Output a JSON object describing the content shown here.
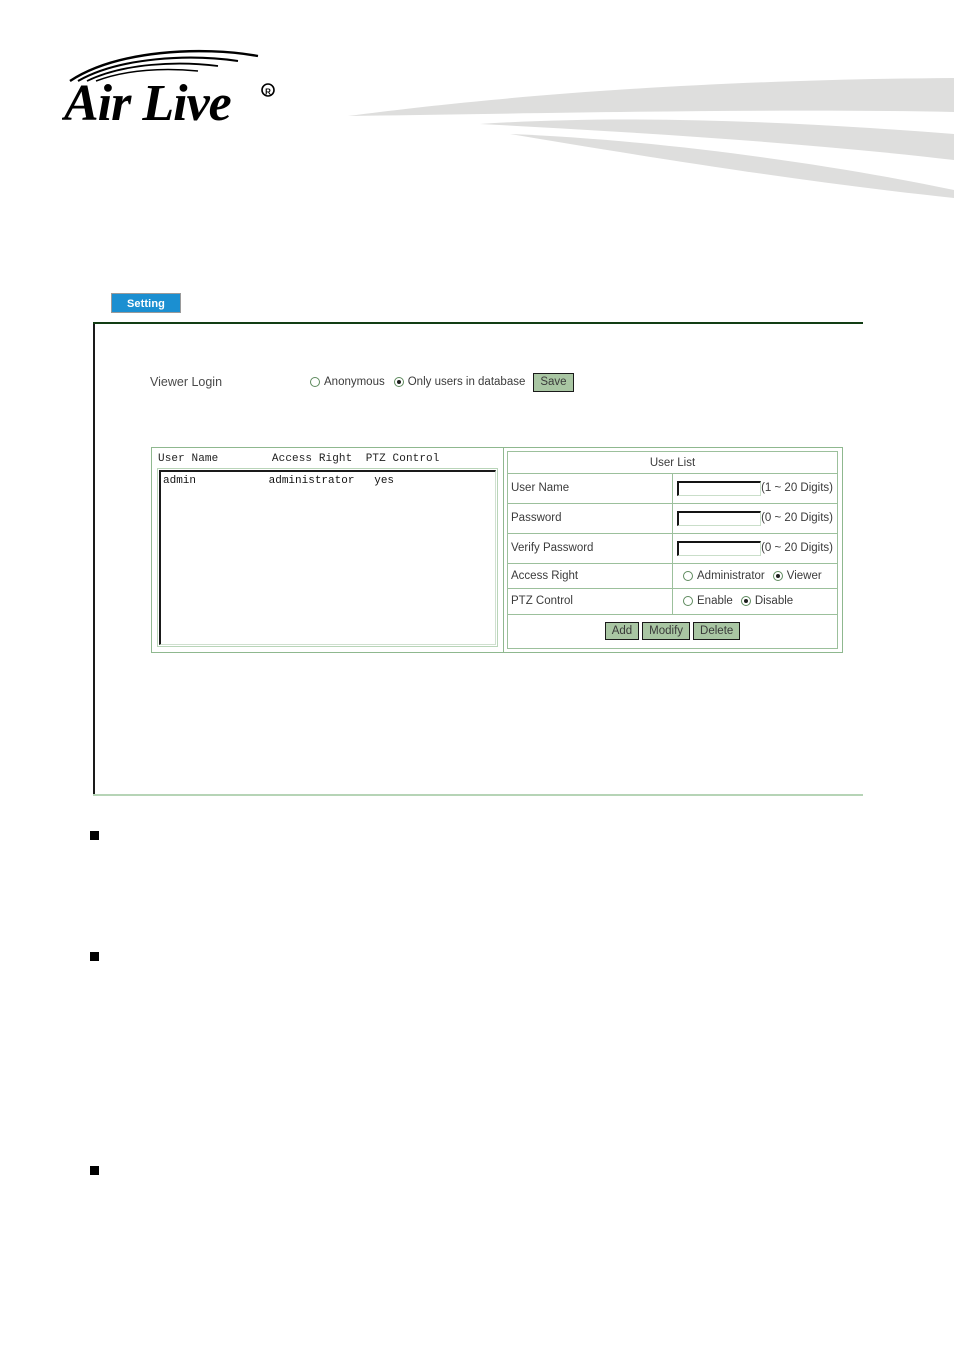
{
  "brand": {
    "name": "Air Live",
    "logo_icon": "airlive-logo",
    "registered_mark": "®",
    "banner_icon": "banner-swoosh"
  },
  "tab": {
    "label": "Setting",
    "accent_color": "#1b8fd1"
  },
  "panel": {
    "border_top_color": "#123d14",
    "border_bottom_color": "#b6d4b6"
  },
  "viewer_login": {
    "label": "Viewer Login",
    "options": [
      {
        "label": "Anonymous",
        "selected": false
      },
      {
        "label": "Only users in database",
        "selected": true
      }
    ],
    "save_label": "Save",
    "button_color": "#a9c6a3"
  },
  "user_table": {
    "header_line": "User Name        Access Right  PTZ Control",
    "columns": [
      "User Name",
      "Access Right",
      "PTZ Control"
    ],
    "rows": [
      {
        "line": "admin           administrator   yes",
        "user_name": "admin",
        "access_right": "administrator",
        "ptz_control": "yes"
      }
    ]
  },
  "user_form": {
    "title": "User List",
    "fields": [
      {
        "label": "User Name",
        "value": "",
        "hint": "(1 ~ 20 Digits)"
      },
      {
        "label": "Password",
        "value": "",
        "hint": "(0 ~ 20 Digits)"
      },
      {
        "label": "Verify Password",
        "value": "",
        "hint": "(0 ~ 20 Digits)"
      }
    ],
    "access_right": {
      "label": "Access Right",
      "options": [
        {
          "label": "Administrator",
          "selected": false
        },
        {
          "label": "Viewer",
          "selected": true
        }
      ]
    },
    "ptz_control": {
      "label": "PTZ Control",
      "options": [
        {
          "label": "Enable",
          "selected": false
        },
        {
          "label": "Disable",
          "selected": true
        }
      ]
    },
    "buttons": [
      {
        "label": "Add"
      },
      {
        "label": "Modify"
      },
      {
        "label": "Delete"
      }
    ]
  },
  "bullets": [
    {
      "marker": "black-square"
    },
    {
      "marker": "black-square"
    },
    {
      "marker": "black-square"
    }
  ]
}
